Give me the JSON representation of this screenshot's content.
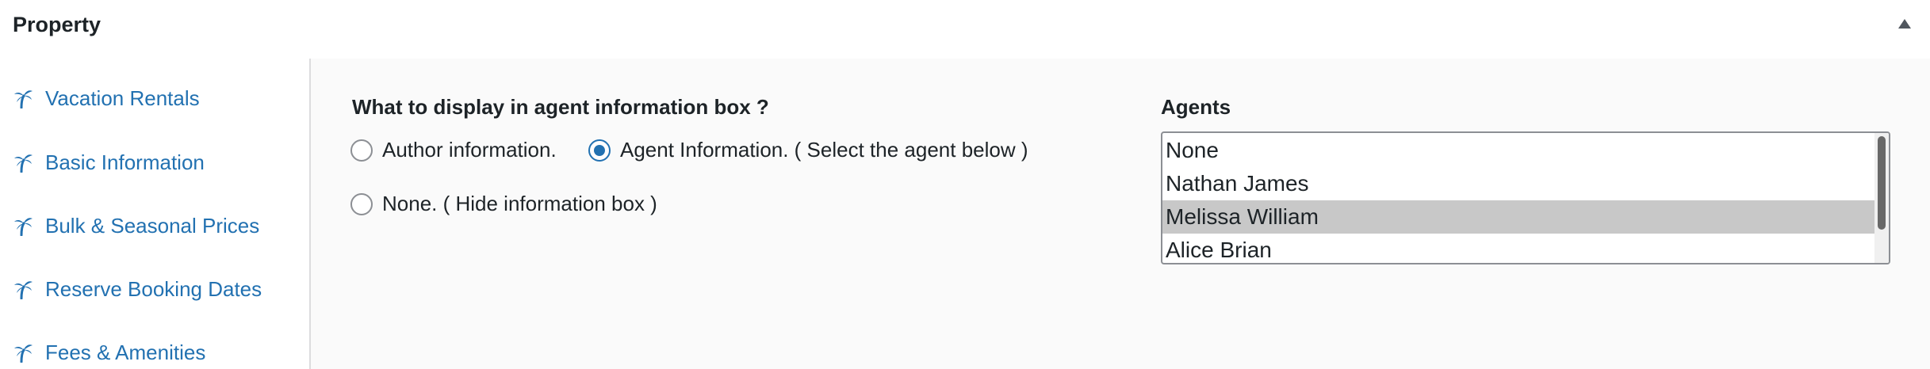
{
  "header": {
    "title": "Property",
    "toggle_icon": "triangle-up-icon"
  },
  "sidebar": {
    "icon": "palm-tree-icon",
    "icon_color": "#2271b1",
    "items": [
      {
        "label": "Vacation Rentals"
      },
      {
        "label": "Basic Information"
      },
      {
        "label": "Bulk & Seasonal Prices"
      },
      {
        "label": "Reserve Booking Dates"
      },
      {
        "label": "Fees & Amenities"
      }
    ]
  },
  "main": {
    "question": "What to display in agent information box ?",
    "options": [
      {
        "label": "Author information.",
        "checked": false
      },
      {
        "label": "Agent Information. ( Select the agent below )",
        "checked": true
      },
      {
        "label": "None. ( Hide information box )",
        "checked": false
      }
    ],
    "agents": {
      "label": "Agents",
      "items": [
        "None",
        "Nathan James",
        "Melissa William",
        "Alice Brian"
      ],
      "selected": "Melissa William"
    }
  },
  "colors": {
    "accent": "#2271b1",
    "text": "#1d2327",
    "selected_row": "#c8c8c8",
    "content_bg": "#fafafa"
  }
}
